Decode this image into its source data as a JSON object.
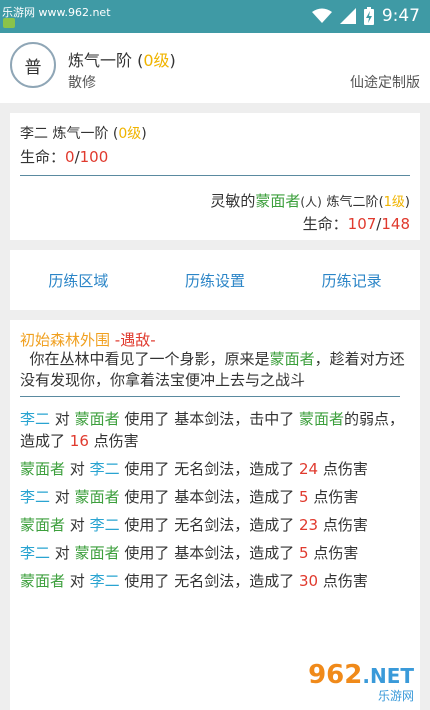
{
  "statusbar": {
    "watermark": "乐游网 www.962.net",
    "time": "9:47"
  },
  "header": {
    "avatar_text": "普",
    "name": "炼气一阶",
    "level": "0级",
    "faction": "散修",
    "right_text": "仙途定制版"
  },
  "battle": {
    "player": {
      "name": "李二",
      "realm": "炼气一阶",
      "level": "0级",
      "hp_label": "生命：",
      "hp_current": "0",
      "hp_max": "100"
    },
    "enemy": {
      "prefix": "灵敏的",
      "name": "蒙面者",
      "race": "(人)",
      "realm": "炼气二阶",
      "level": "1级",
      "hp_label": "生命：",
      "hp_current": "107",
      "hp_max": "148"
    }
  },
  "tabs": {
    "area": "历练区域",
    "settings": "历练设置",
    "records": "历练记录"
  },
  "log": {
    "location": "初始森林外围",
    "event": "-遇敌-",
    "intro_a": "你在丛林中看见了一个身影，原来是",
    "intro_enemy": "蒙面者",
    "intro_b": "，趁着对方还没有发现你，你拿着法宝便冲上去与之战斗",
    "entries": [
      {
        "attacker": "李二",
        "target": "蒙面者",
        "skill": "基本剑法",
        "pre": "，击中了",
        "weak_target": "蒙面者",
        "weak": "的弱点，造成了",
        "damage": "16",
        "suffix": "点伤害"
      },
      {
        "attacker": "蒙面者",
        "target": "李二",
        "skill": "无名剑法",
        "pre": "，造成了",
        "damage": "24",
        "suffix": "点伤害"
      },
      {
        "attacker": "李二",
        "target": "蒙面者",
        "skill": "基本剑法",
        "pre": "，造成了",
        "damage": "5",
        "suffix": "点伤害"
      },
      {
        "attacker": "蒙面者",
        "target": "李二",
        "skill": "无名剑法",
        "pre": "，造成了",
        "damage": "23",
        "suffix": "点伤害"
      },
      {
        "attacker": "李二",
        "target": "蒙面者",
        "skill": "基本剑法",
        "pre": "，造成了",
        "damage": "5",
        "suffix": "点伤害"
      },
      {
        "attacker": "蒙面者",
        "target": "李二",
        "skill": "无名剑法",
        "pre": "，造成了",
        "damage": "30",
        "suffix": "点伤害"
      }
    ],
    "words": {
      "to": "对",
      "used": "使用了"
    }
  },
  "watermark_logo": {
    "big": "962",
    "net": ".NET",
    "small": "乐游网"
  }
}
